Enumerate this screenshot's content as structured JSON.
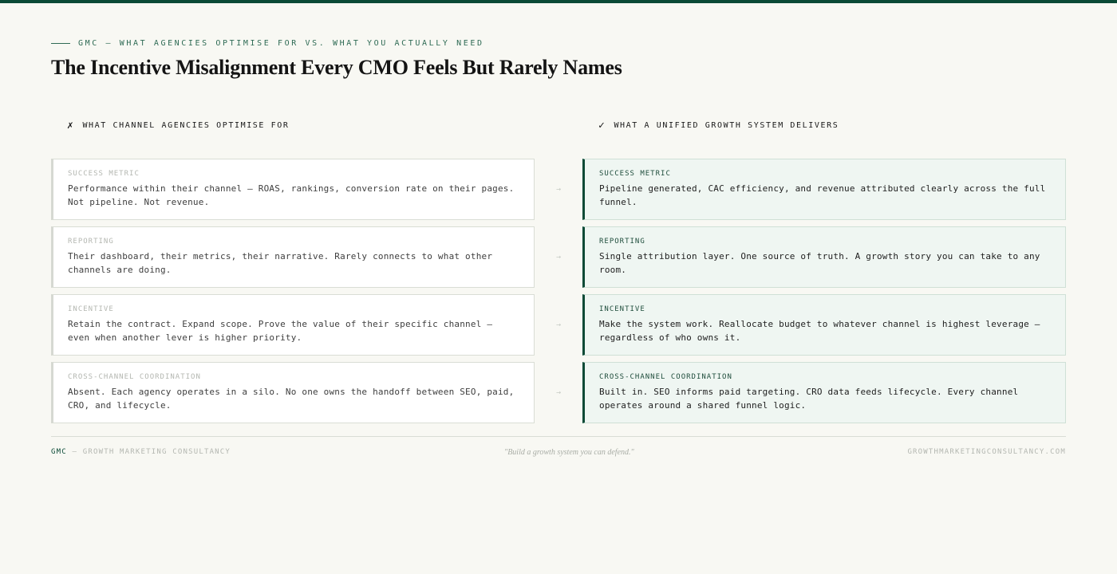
{
  "eyebrow": "GMC — WHAT AGENCIES OPTIMISE FOR VS. WHAT YOU ACTUALLY NEED",
  "title": "The Incentive Misalignment Every CMO Feels But Rarely Names",
  "columns": {
    "left": {
      "mark": "✗",
      "label": "WHAT CHANNEL AGENCIES OPTIMISE FOR"
    },
    "right": {
      "mark": "✓",
      "label": "WHAT A UNIFIED GROWTH SYSTEM DELIVERS"
    }
  },
  "arrow": "→",
  "rows": [
    {
      "agency": {
        "label": "SUCCESS METRIC",
        "text": "Performance within their channel — ROAS, rankings, conversion rate on their pages. Not pipeline. Not revenue."
      },
      "unified": {
        "label": "SUCCESS METRIC",
        "text": "Pipeline generated, CAC efficiency, and revenue attributed clearly across the full funnel."
      }
    },
    {
      "agency": {
        "label": "REPORTING",
        "text": "Their dashboard, their metrics, their narrative. Rarely connects to what other channels are doing."
      },
      "unified": {
        "label": "REPORTING",
        "text": "Single attribution layer. One source of truth. A growth story you can take to any room."
      }
    },
    {
      "agency": {
        "label": "INCENTIVE",
        "text": "Retain the contract. Expand scope. Prove the value of their specific channel — even when another lever is higher priority."
      },
      "unified": {
        "label": "INCENTIVE",
        "text": "Make the system work. Reallocate budget to whatever channel is highest leverage — regardless of who owns it."
      }
    },
    {
      "agency": {
        "label": "CROSS-CHANNEL COORDINATION",
        "text": "Absent. Each agency operates in a silo. No one owns the handoff between SEO, paid, CRO, and lifecycle."
      },
      "unified": {
        "label": "CROSS-CHANNEL COORDINATION",
        "text": "Built in. SEO informs paid targeting. CRO data feeds lifecycle. Every channel operates around a shared funnel logic."
      }
    }
  ],
  "footer": {
    "brand": "GMC",
    "brand_suffix": "— GROWTH MARKETING CONSULTANCY",
    "tagline": "\"Build a growth system you can defend.\"",
    "url": "GROWTHMARKETINGCONSULTANCY.COM"
  },
  "colors": {
    "accent": "#0b4a36",
    "background": "#f8f8f3",
    "unified_bg": "#eff6f2"
  }
}
